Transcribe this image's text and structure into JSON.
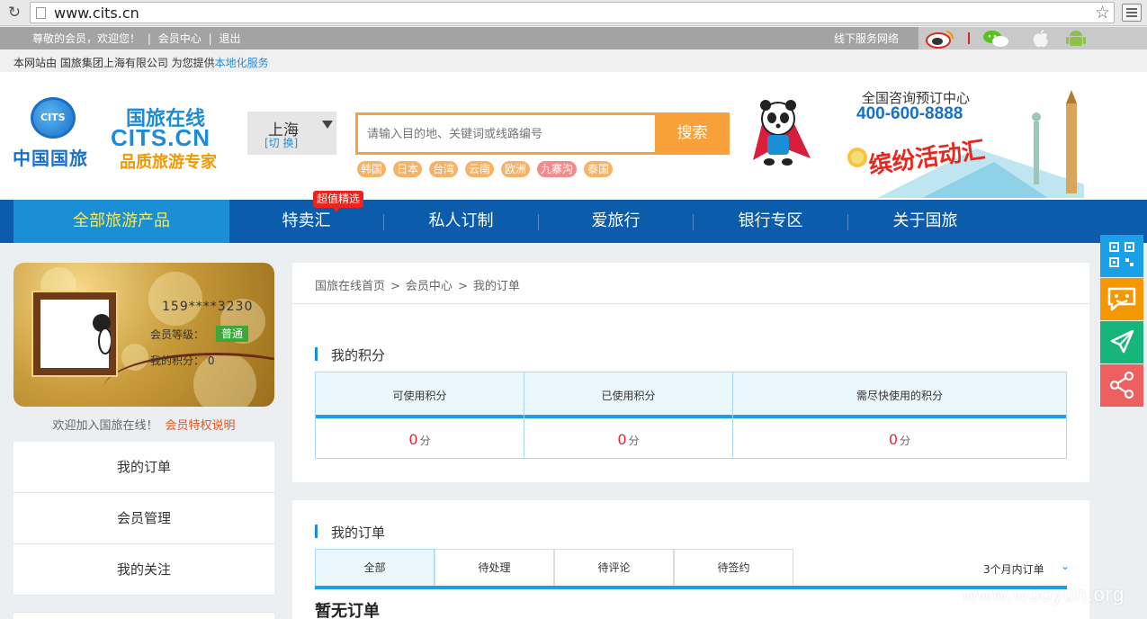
{
  "browser": {
    "url": "www.cits.cn"
  },
  "topbar": {
    "welcome": "尊敬的会员，欢迎您！",
    "member_center": "会员中心",
    "logout": "退出",
    "sep": "|",
    "offline_network": "线下服务网络"
  },
  "subline": {
    "text": "本网站由 国旅集团上海有限公司 为您提供",
    "link": "本地化服务"
  },
  "header": {
    "logo_globe": "CITS",
    "logo_cn": "中国国旅",
    "logo2_line1": "国旅在线",
    "logo2_line2": "CITS.CN",
    "logo2_line3": "品质旅游专家",
    "city": "上海",
    "city_switch": "[切 换]",
    "search_placeholder": "请输入目的地、关键词或线路编号",
    "search_button": "搜索",
    "tags": [
      "韩国",
      "日本",
      "台湾",
      "云南",
      "欧洲",
      "九寨沟",
      "泰国"
    ],
    "hotline_title": "全国咨询预订中心",
    "hotline_number": "400-600-8888",
    "promo": "缤纷活动汇"
  },
  "nav": {
    "all": "全部旅游产品",
    "items": [
      "特卖汇",
      "私人订制",
      "爱旅行",
      "银行专区",
      "关于国旅"
    ],
    "badge": "超值精选"
  },
  "member": {
    "phone": "159****3230",
    "level_label": "会员等级：",
    "level": "普通",
    "points_label": "我的积分：",
    "points": "0",
    "join_text": "欢迎加入国旅在线！",
    "privilege_link": "会员特权说明"
  },
  "side_menu": [
    "我的订单",
    "会员管理",
    "我的关注"
  ],
  "breadcrumb": [
    "国旅在线首页",
    "会员中心",
    "我的订单"
  ],
  "points_section": {
    "title": "我的积分",
    "columns": [
      "可使用积分",
      "已使用积分",
      "需尽快使用的积分"
    ],
    "values": [
      "0",
      "0",
      "0"
    ],
    "unit": "分"
  },
  "orders_section": {
    "title": "我的订单",
    "tabs": [
      "全部",
      "待处理",
      "待评论",
      "待签约"
    ],
    "range": "3个月内订单",
    "empty": "暂无订单"
  },
  "watermark": "www.wooyun.org",
  "colors": {
    "nav": "#0b5cab",
    "accent": "#f8a03a",
    "blue": "#1b8fd6"
  }
}
